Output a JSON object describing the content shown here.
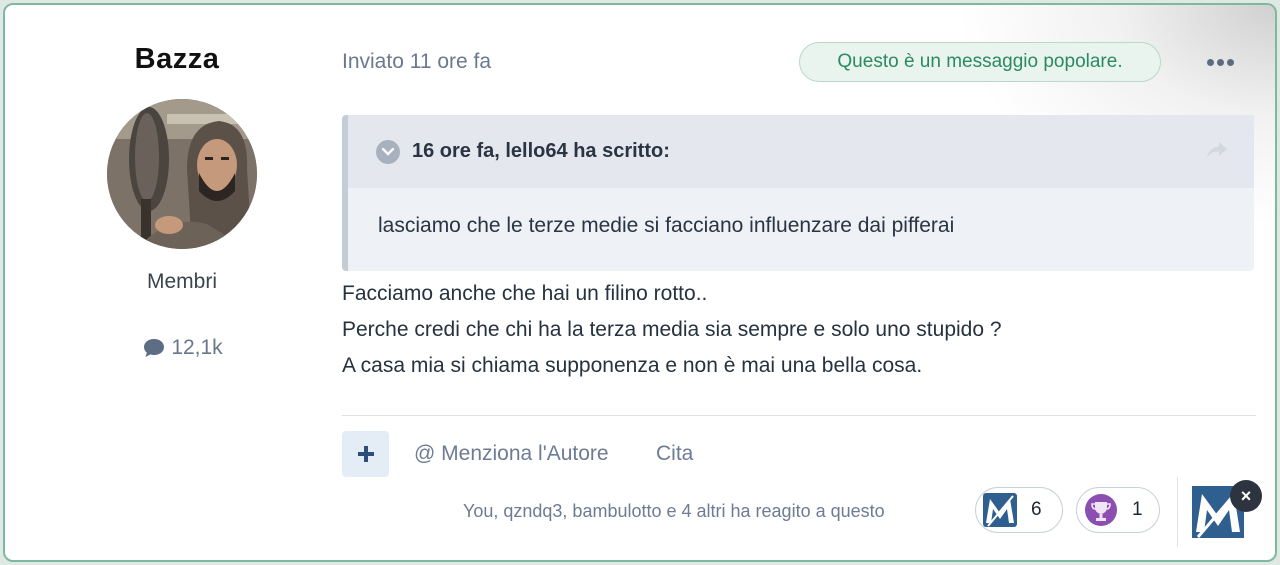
{
  "author": {
    "name": "Bazza",
    "group": "Membri",
    "post_count": "12,1k",
    "avatar_icon": "user-photo"
  },
  "post": {
    "date": "Inviato 11 ore fa",
    "badge": "Questo è un messaggio popolare.",
    "more_icon": "ellipsis-icon",
    "quote": {
      "header": "16 ore fa, lello64 ha scritto:",
      "text": "lasciamo che le terze medie si facciano influenzare dai pifferai"
    },
    "lines": [
      "Facciamo anche che hai un filino rotto..",
      "Perche credi che chi ha la terza media sia sempre e solo uno stupido ?",
      "A casa mia si chiama supponenza e non è mai una bella cosa."
    ]
  },
  "actions": {
    "add_icon": "plus-icon",
    "mention": "@ Menziona l'Autore",
    "quote": "Cita"
  },
  "reactions": {
    "summary": "You, qzndq3, bambulotto e 4 altri ha reagito a questo",
    "items": [
      {
        "icon": "brand-like-icon",
        "count": "6"
      },
      {
        "icon": "trophy-icon",
        "count": "1"
      }
    ],
    "close_label": "×"
  },
  "colors": {
    "accent_green": "#2b8a63",
    "card_border": "#7fb8a0",
    "brand_blue": "#2f5f8f"
  }
}
